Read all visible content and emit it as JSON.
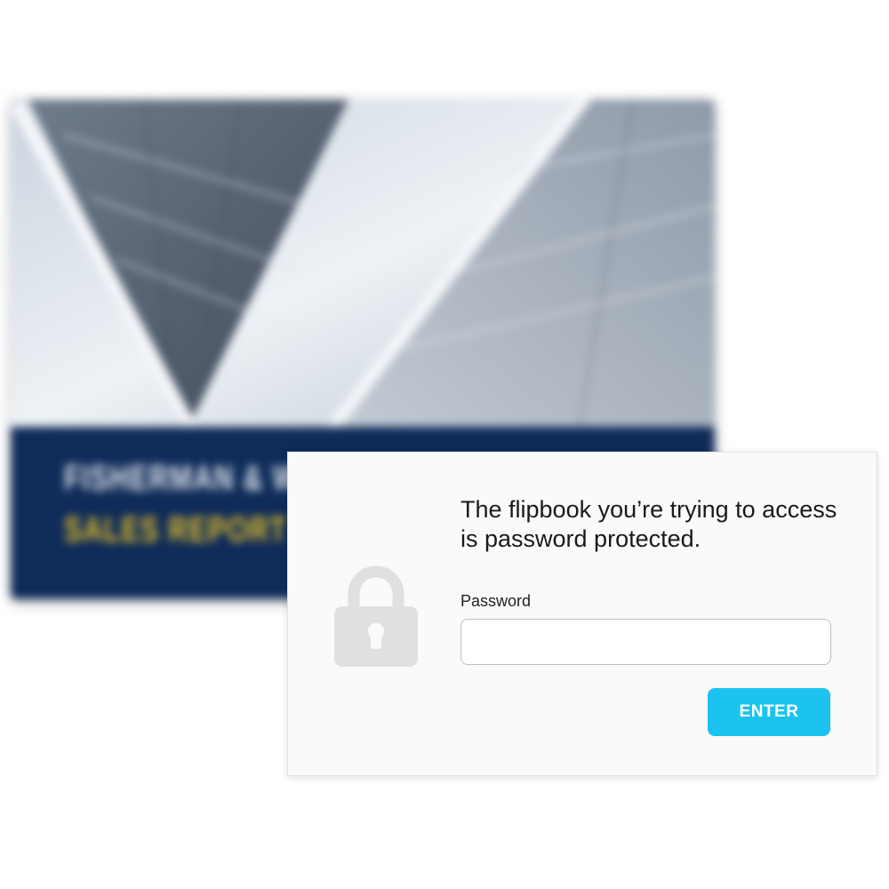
{
  "cover": {
    "title": "FISHERMAN & W",
    "subtitle": "SALES REPORT",
    "band_color": "#0f2b59",
    "accent_color": "#e8c22a",
    "photo_icon": "building-facade-image"
  },
  "dialog": {
    "message": "The flipbook you’re trying to access is password protected.",
    "lock_icon": "lock-icon",
    "password": {
      "label": "Password",
      "value": "",
      "placeholder": ""
    },
    "enter_label": "ENTER",
    "enter_color": "#1cc3ef"
  }
}
